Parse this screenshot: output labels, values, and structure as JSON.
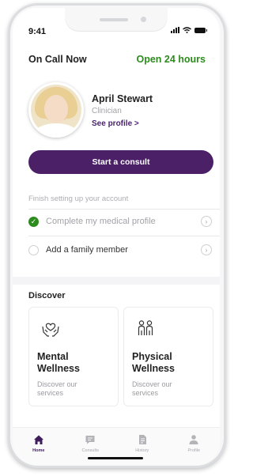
{
  "status_bar": {
    "time": "9:41"
  },
  "header": {
    "on_call": "On Call Now",
    "availability": "Open 24 hours"
  },
  "clinician": {
    "name": "April Stewart",
    "role": "Clinician",
    "see_profile": "See profile >"
  },
  "actions": {
    "start_consult": "Start a consult"
  },
  "setup": {
    "title": "Finish setting up your account",
    "items": [
      {
        "label": "Complete my medical profile",
        "completed": true
      },
      {
        "label": "Add a family member",
        "completed": false
      }
    ]
  },
  "discover": {
    "title": "Discover",
    "cards": [
      {
        "title_line1": "Mental",
        "title_line2": "Wellness",
        "sub_line1": "Discover our",
        "sub_line2": "services",
        "icon": "hands-heart-icon"
      },
      {
        "title_line1": "Physical",
        "title_line2": "Wellness",
        "sub_line1": "Discover our",
        "sub_line2": "services",
        "icon": "people-icon"
      }
    ]
  },
  "tabbar": {
    "tabs": [
      {
        "label": "Home",
        "icon": "home-icon",
        "active": true
      },
      {
        "label": "Consults",
        "icon": "chat-icon",
        "active": false
      },
      {
        "label": "History",
        "icon": "document-icon",
        "active": false
      },
      {
        "label": "Profile",
        "icon": "person-icon",
        "active": false
      }
    ]
  },
  "colors": {
    "accent": "#4b2067",
    "success": "#2e8b1e",
    "muted": "#a3a3a8"
  }
}
